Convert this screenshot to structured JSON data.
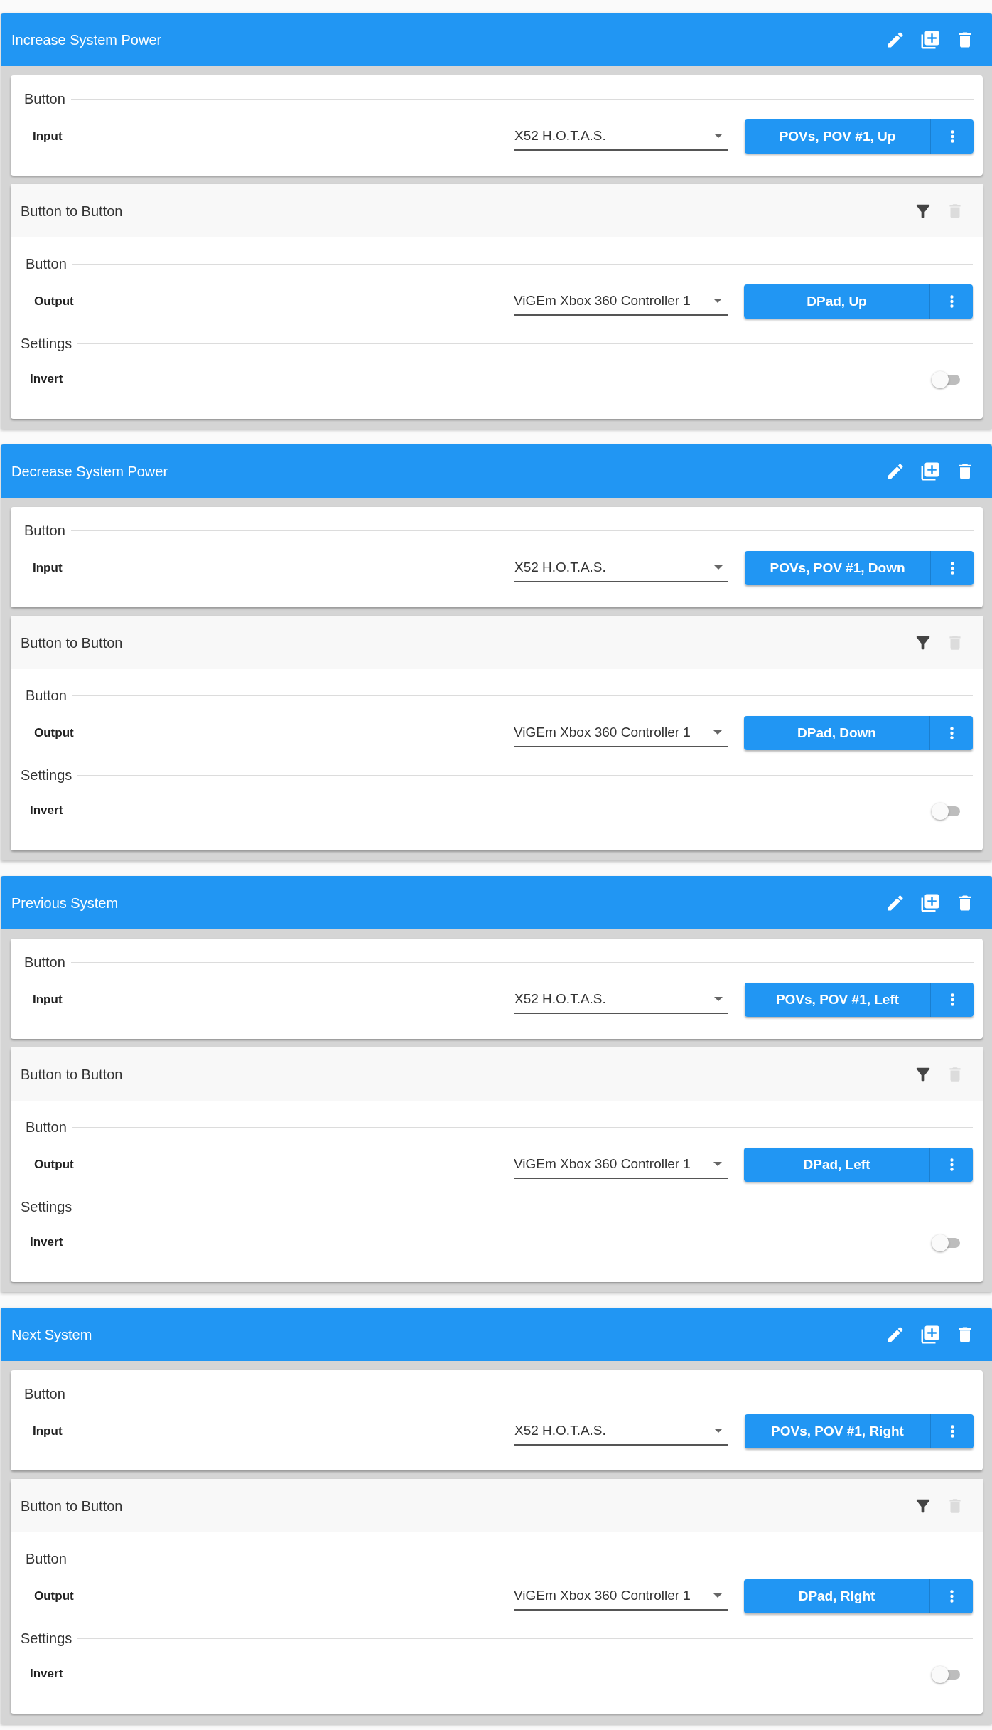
{
  "mappings": [
    {
      "title": "Increase System Power",
      "input": {
        "section": "Button",
        "label": "Input",
        "device": "X52 H.O.T.A.S.",
        "binding": "POVs, POV #1, Up"
      },
      "plugin": {
        "title": "Button to Button",
        "delete_disabled": true,
        "output": {
          "section": "Button",
          "label": "Output",
          "device": "ViGEm Xbox 360 Controller 1",
          "binding": "DPad, Up"
        },
        "settings": {
          "section": "Settings",
          "label": "Invert",
          "on": false
        }
      }
    },
    {
      "title": "Decrease System Power",
      "input": {
        "section": "Button",
        "label": "Input",
        "device": "X52 H.O.T.A.S.",
        "binding": "POVs, POV #1, Down"
      },
      "plugin": {
        "title": "Button to Button",
        "delete_disabled": true,
        "output": {
          "section": "Button",
          "label": "Output",
          "device": "ViGEm Xbox 360 Controller 1",
          "binding": "DPad, Down"
        },
        "settings": {
          "section": "Settings",
          "label": "Invert",
          "on": false
        }
      }
    },
    {
      "title": "Previous System",
      "input": {
        "section": "Button",
        "label": "Input",
        "device": "X52 H.O.T.A.S.",
        "binding": "POVs, POV #1, Left"
      },
      "plugin": {
        "title": "Button to Button",
        "delete_disabled": true,
        "output": {
          "section": "Button",
          "label": "Output",
          "device": "ViGEm Xbox 360 Controller 1",
          "binding": "DPad, Left"
        },
        "settings": {
          "section": "Settings",
          "label": "Invert",
          "on": false
        }
      }
    },
    {
      "title": "Next System",
      "input": {
        "section": "Button",
        "label": "Input",
        "device": "X52 H.O.T.A.S.",
        "binding": "POVs, POV #1, Right"
      },
      "plugin": {
        "title": "Button to Button",
        "delete_disabled": true,
        "output": {
          "section": "Button",
          "label": "Output",
          "device": "ViGEm Xbox 360 Controller 1",
          "binding": "DPad, Right"
        },
        "settings": {
          "section": "Settings",
          "label": "Invert",
          "on": false
        }
      }
    }
  ]
}
